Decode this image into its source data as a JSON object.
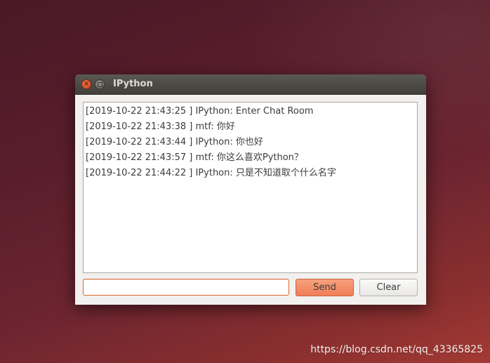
{
  "window": {
    "title": "IPython"
  },
  "chat": {
    "messages": [
      "[2019-10-22 21:43:25 ] IPython: Enter Chat Room",
      "[2019-10-22 21:43:38 ] mtf: 你好",
      "[2019-10-22 21:43:44 ] IPython: 你也好",
      "[2019-10-22 21:43:57 ] mtf: 你这么喜欢Python？",
      "[2019-10-22 21:44:22 ] IPython: 只是不知道取个什么名字"
    ]
  },
  "input": {
    "value": "",
    "placeholder": ""
  },
  "buttons": {
    "send_label": "Send",
    "clear_label": "Clear"
  },
  "watermark": {
    "text": "https://blog.csdn.net/qq_43365825"
  },
  "colors": {
    "accent": "#ef7f57",
    "input_focus_border": "#e2672f"
  }
}
